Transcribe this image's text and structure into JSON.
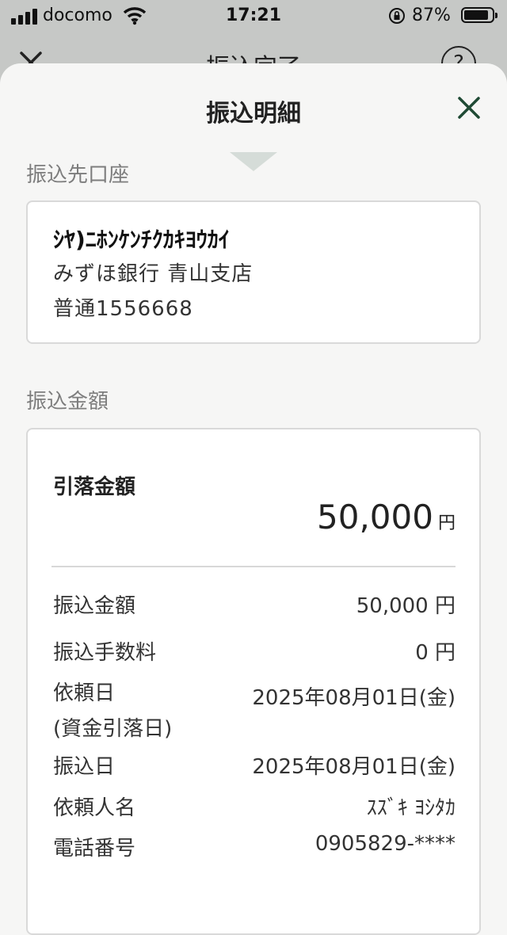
{
  "status_bar": {
    "carrier": "docomo",
    "time": "17:21",
    "battery": "87%",
    "battery_level": 0.87
  },
  "background_screen": {
    "title": "振込完了",
    "help_label": "?"
  },
  "sheet": {
    "title": "振込明細",
    "destination": {
      "label": "振込先口座",
      "account_name": "ｼﾔ)ﾆﾎﾝｹﾝﾁｸｶｷﾖｳｶｲ",
      "bank_branch": "みずほ銀行 青山支店",
      "account_number": "普通1556668"
    },
    "amount_section": {
      "label": "振込金額",
      "withdrawal_label": "引落金額",
      "withdrawal_amount": "50,000",
      "withdrawal_unit": "円",
      "rows": [
        {
          "label": "振込金額",
          "value": "50,000 円"
        },
        {
          "label": "振込手数料",
          "value": "0 円"
        },
        {
          "label": "依頼日",
          "label2": "(資金引落日)",
          "value": "2025年08月01日(金)"
        },
        {
          "label": "振込日",
          "value": "2025年08月01日(金)"
        },
        {
          "label": "依頼人名",
          "value": "ｽｽﾞｷ ﾖｼﾀｶ"
        },
        {
          "label": "電話番号",
          "value": "0905829-****"
        }
      ]
    }
  },
  "colors": {
    "accent": "#1f4a34",
    "sheet_bg": "#f6f6f5",
    "overlay_bg": "#c6c8c6",
    "section_label": "#7d7d7d"
  }
}
